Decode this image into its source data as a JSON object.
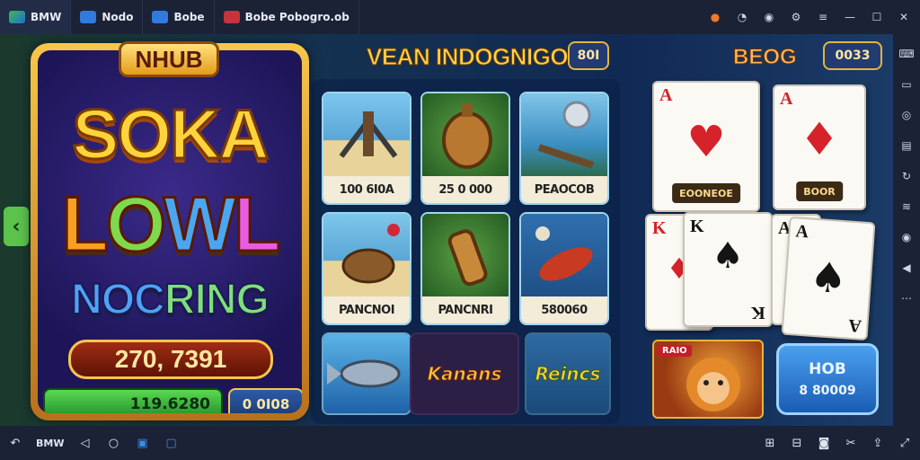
{
  "topbar": {
    "tabs": [
      {
        "label": "BMW"
      },
      {
        "label": "Nodo"
      },
      {
        "label": "Bobe"
      },
      {
        "label": "Bobe Pobogro.ob"
      }
    ]
  },
  "left_panel": {
    "banner": "NHUB",
    "headline_1": "SOKA",
    "headline_2": [
      "L",
      "O",
      "W",
      "L"
    ],
    "headline_3": [
      "NOC",
      "RING"
    ],
    "score": "270, 7391",
    "balance": "119.6280",
    "balance_chip": "0 0I08"
  },
  "middle_panel": {
    "title": "VEAN INDOGNIGO",
    "chip": "80I",
    "tiles": [
      {
        "caption": "100 6I0A"
      },
      {
        "caption": "25 0 000"
      },
      {
        "caption": "PEAOCOB"
      },
      {
        "caption": "PANCNOI"
      },
      {
        "caption": "PANCNRI"
      },
      {
        "caption": "580060"
      },
      {
        "caption": ""
      },
      {
        "caption": "Kanans"
      },
      {
        "caption": "Reincs"
      }
    ]
  },
  "right_panel": {
    "title": "BEOG",
    "chip": "0033",
    "cards": [
      {
        "rank": "A",
        "suit": "♥",
        "plate": "EOONEOE"
      },
      {
        "rank": "A",
        "suit": "♦",
        "plate": "BOOR"
      },
      {
        "rank": "K",
        "suit": "♦",
        "plate": ""
      },
      {
        "rank": "K",
        "suit": "♠",
        "plate": ""
      },
      {
        "rank": "A",
        "suit": "♠",
        "plate": ""
      },
      {
        "rank": "A",
        "suit": "♠",
        "plate": ""
      }
    ],
    "lion_tag": "RAIO",
    "hob_line1": "HOB",
    "hob_line2": "8 80009"
  },
  "bottombar": {
    "label": "BMW"
  },
  "colors": {
    "gold": "#f7c64a",
    "panel_blue": "#223b72",
    "green_bar": "#5bd852",
    "red_suit": "#d6222a"
  }
}
